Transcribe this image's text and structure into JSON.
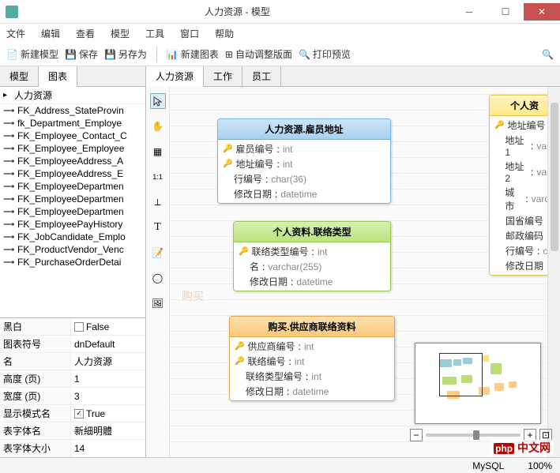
{
  "window": {
    "title": "人力资源 - 模型"
  },
  "menu": [
    "文件",
    "编辑",
    "查看",
    "模型",
    "工具",
    "窗口",
    "帮助"
  ],
  "toolbar": {
    "new_model": "新建模型",
    "save": "保存",
    "save_as": "另存为",
    "new_diagram": "新建图表",
    "auto_layout": "自动调整版面",
    "print_preview": "打印预览"
  },
  "left_tabs": {
    "model": "模型",
    "diagram": "图表"
  },
  "tree": {
    "root": "人力资源",
    "items": [
      "FK_Address_StateProvin",
      "fk_Department_Employe",
      "FK_Employee_Contact_C",
      "FK_Employee_Employee",
      "FK_EmployeeAddress_A",
      "FK_EmployeeAddress_E",
      "FK_EmployeeDepartmen",
      "FK_EmployeeDepartmen",
      "FK_EmployeeDepartmen",
      "FK_EmployeePayHistory",
      "FK_JobCandidate_Emplo",
      "FK_ProductVendor_Venc",
      "FK_PurchaseOrderDetai"
    ]
  },
  "props": [
    {
      "name": "黑白",
      "value": "False",
      "checkbox": false
    },
    {
      "name": "图表符号",
      "value": "dnDefault"
    },
    {
      "name": "名",
      "value": "人力资源"
    },
    {
      "name": "高度 (页)",
      "value": "1"
    },
    {
      "name": "宽度 (页)",
      "value": "3"
    },
    {
      "name": "显示模式名",
      "value": "True",
      "checkbox": true
    },
    {
      "name": "表字体名",
      "value": "新細明體"
    },
    {
      "name": "表字体大小",
      "value": "14"
    }
  ],
  "center_tabs": [
    "人力资源",
    "工作",
    "员工"
  ],
  "entities": {
    "e1": {
      "title": "人力资源.雇员地址",
      "fields": [
        {
          "key": true,
          "name": "雇员编号",
          "type": "int"
        },
        {
          "key": true,
          "name": "地址编号",
          "type": "int"
        },
        {
          "key": false,
          "name": "行编号",
          "type": "char(36)"
        },
        {
          "key": false,
          "name": "修改日期",
          "type": "datetime"
        }
      ]
    },
    "e2": {
      "title": "个人资料.联络类型",
      "fields": [
        {
          "key": true,
          "name": "联络类型编号",
          "type": "int"
        },
        {
          "key": false,
          "name": "名",
          "type": "varchar(255)"
        },
        {
          "key": false,
          "name": "修改日期",
          "type": "datetime"
        }
      ]
    },
    "e3": {
      "title": "购买.供应商联络资料",
      "fields": [
        {
          "key": true,
          "name": "供应商编号",
          "type": "int"
        },
        {
          "key": true,
          "name": "联络编号",
          "type": "int"
        },
        {
          "key": false,
          "name": "联络类型编号",
          "type": "int"
        },
        {
          "key": false,
          "name": "修改日期",
          "type": "datetime"
        }
      ]
    },
    "e4": {
      "title": "个人资",
      "fields": [
        {
          "key": true,
          "name": "地址编号"
        },
        {
          "key": false,
          "name": "地址1",
          "type": "varc"
        },
        {
          "key": false,
          "name": "地址2",
          "type": "varc"
        },
        {
          "key": false,
          "name": "城市",
          "type": "varch"
        },
        {
          "key": false,
          "name": "国省编号"
        },
        {
          "key": false,
          "name": "邮政编码"
        },
        {
          "key": false,
          "name": "行编号",
          "type": "ch"
        },
        {
          "key": false,
          "name": "修改日期"
        }
      ]
    }
  },
  "watermarks": {
    "buy": "购买"
  },
  "status": {
    "db": "MySQL",
    "zoom": "100%"
  },
  "php_watermark": "php 中文网"
}
